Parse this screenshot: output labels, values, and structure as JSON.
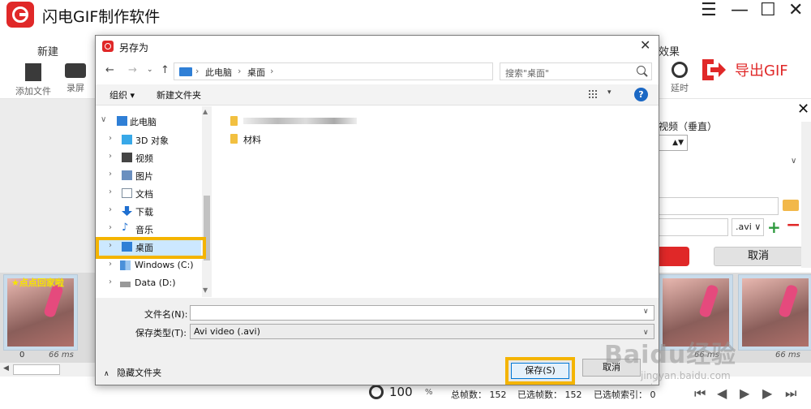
{
  "app": {
    "title": "闪电GIF制作软件",
    "window_controls": [
      "☰",
      "—",
      "☐",
      "✕"
    ]
  },
  "toolbar": {
    "new_label": "新建",
    "add_file_label": "添加文件",
    "record_label": "录屏",
    "effects_label": "效果",
    "delay_label": "延时",
    "export_label": "导出GIF"
  },
  "right_panel": {
    "label": "视频（垂直）",
    "close": "✕",
    "format_value": ".avi",
    "cancel_label": "取消"
  },
  "frames": [
    {
      "index": "0",
      "duration": "66 ms",
      "watermark": "★点点回家啦"
    },
    {
      "index": "",
      "duration": "66 ms"
    },
    {
      "index": "",
      "duration": "66 ms"
    },
    {
      "index": "",
      "duration": "66 ms"
    }
  ],
  "status": {
    "zoom": "100",
    "zoom_unit": "%",
    "total_frames": "总帧数：  152",
    "selected_frames": "已选帧数：  152",
    "selected_index": "已选帧索引：  0"
  },
  "dialog": {
    "title": "另存为",
    "close": "✕",
    "nav": {
      "back": "←",
      "forward": "→",
      "recent": "⌄",
      "up": "↑"
    },
    "breadcrumb": [
      "此电脑",
      "桌面"
    ],
    "search_placeholder": "搜索\"桌面\"",
    "cmd": {
      "organize": "组织 ▾",
      "new_folder": "新建文件夹",
      "help": "?"
    },
    "tree": [
      {
        "label": "此电脑",
        "expander": "∨",
        "icon_color": "#2f7fd6",
        "indent": 0
      },
      {
        "label": "3D 对象",
        "expander": "›",
        "icon_color": "#38a8e8",
        "indent": 1
      },
      {
        "label": "视频",
        "expander": "›",
        "icon_color": "#444",
        "indent": 1
      },
      {
        "label": "图片",
        "expander": "›",
        "icon_color": "#6a8fbf",
        "indent": 1
      },
      {
        "label": "文档",
        "expander": "›",
        "icon_color": "#7e8e9e",
        "indent": 1
      },
      {
        "label": "下载",
        "expander": "›",
        "icon_color": "#1f6fd0",
        "indent": 1
      },
      {
        "label": "音乐",
        "expander": "›",
        "icon_color": "#1f6fd0",
        "indent": 1
      },
      {
        "label": "桌面",
        "expander": "›",
        "icon_color": "#2f7fd6",
        "indent": 1,
        "selected": true
      },
      {
        "label": "Windows (C:)",
        "expander": "›",
        "icon_color": "#4a90d9",
        "indent": 1
      },
      {
        "label": "Data (D:)",
        "expander": "›",
        "icon_color": "#888",
        "indent": 1
      }
    ],
    "files": [
      {
        "name": "",
        "blurred": true
      },
      {
        "name": "材料"
      }
    ],
    "filename_label": "文件名(N):",
    "filename_value": "",
    "filetype_label": "保存类型(T):",
    "filetype_value": "Avi video (.avi)",
    "hide_folders_label": "隐藏文件夹",
    "save_label": "保存(S)",
    "cancel_label": "取消"
  },
  "watermark": {
    "main": "Baidu经验",
    "sub": "jingyan.baidu.com"
  },
  "colors": {
    "brand_red": "#e02828",
    "highlight": "#f4b400",
    "selection": "#cce8ff",
    "focus_blue": "#0078d7"
  }
}
